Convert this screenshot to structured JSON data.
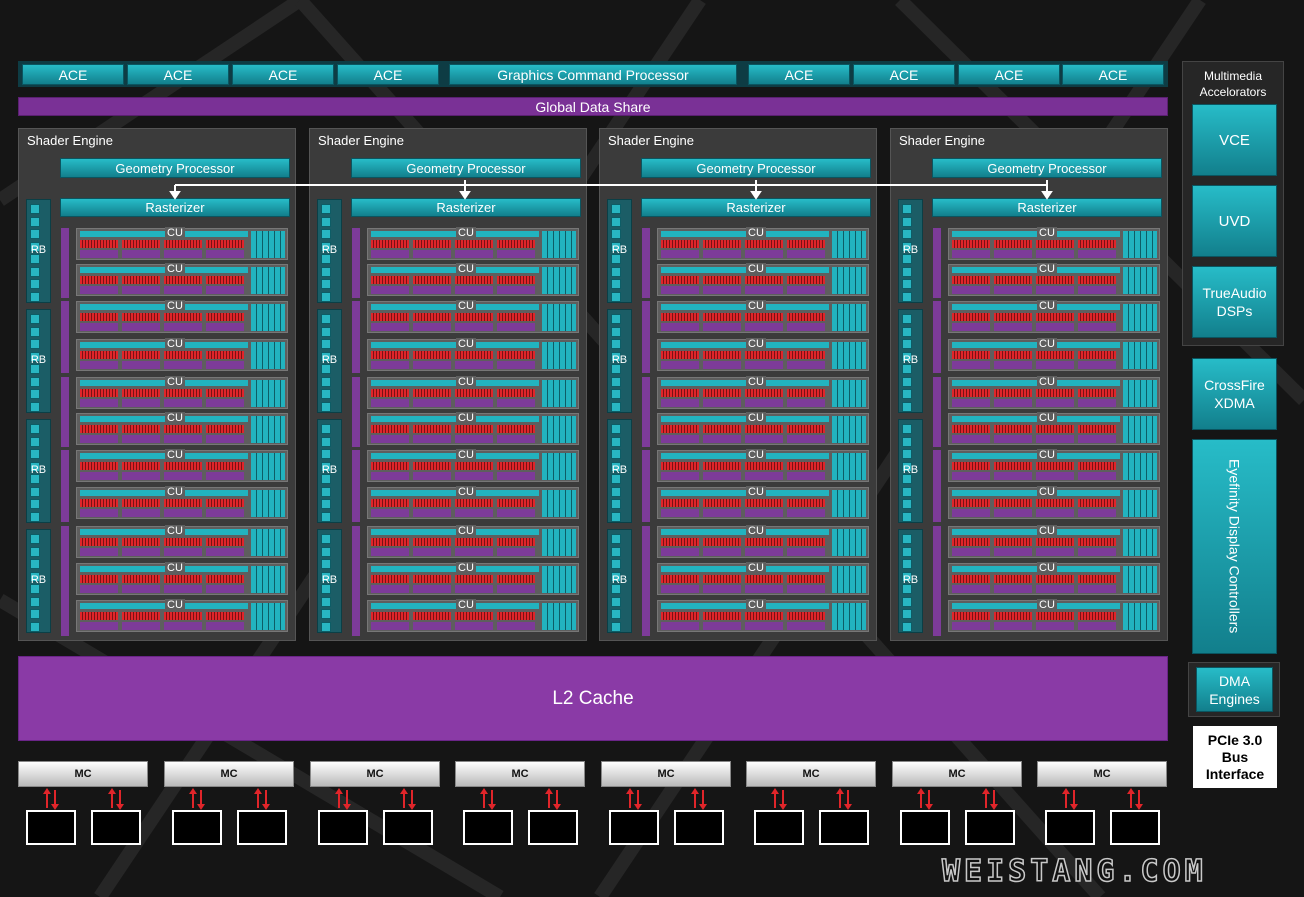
{
  "top_bar": {
    "left_aces": [
      "ACE",
      "ACE",
      "ACE",
      "ACE"
    ],
    "command_processor": "Graphics Command Processor",
    "right_aces": [
      "ACE",
      "ACE",
      "ACE",
      "ACE"
    ]
  },
  "global_data_share": "Global Data Share",
  "shader_engines": [
    {
      "title": "Shader Engine",
      "geometry": "Geometry Processor",
      "rasterizer": "Rasterizer"
    },
    {
      "title": "Shader Engine",
      "geometry": "Geometry Processor",
      "rasterizer": "Rasterizer"
    },
    {
      "title": "Shader Engine",
      "geometry": "Geometry Processor",
      "rasterizer": "Rasterizer"
    },
    {
      "title": "Shader Engine",
      "geometry": "Geometry Processor",
      "rasterizer": "Rasterizer"
    }
  ],
  "compute_unit_label": "CU",
  "render_backend_label": "RB",
  "l2_cache": "L2 Cache",
  "memory_controller_label": "MC",
  "side_panel": {
    "multimedia_title": "Multimedia Accelorators",
    "vce": "VCE",
    "uvd": "UVD",
    "trueaudio": "TrueAudio DSPs",
    "crossfire": "CrossFire XDMA",
    "eyefinity": "Eyefinity Display Controllers",
    "dma": "DMA Engines",
    "pcie": "PCIe 3.0 Bus Interface"
  },
  "watermark": "WEISTANG.COM",
  "colors": {
    "teal": "#22b3bf",
    "purple": "#7d3b99",
    "red": "#e0252a",
    "background": "#151515"
  }
}
